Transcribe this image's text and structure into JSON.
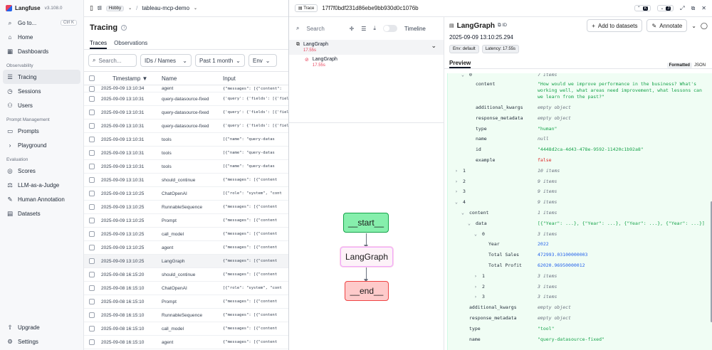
{
  "app": {
    "name": "Langfuse",
    "version": "v3.108.0"
  },
  "sidebar": {
    "goto": {
      "label": "Go to...",
      "shortcut": "Ctrl K"
    },
    "items_top": [
      {
        "label": "Home",
        "icon": "home-icon"
      },
      {
        "label": "Dashboards",
        "icon": "dashboard-icon"
      }
    ],
    "observability_label": "Observability",
    "observability_items": [
      {
        "label": "Tracing",
        "icon": "tracing-icon",
        "active": true
      },
      {
        "label": "Sessions",
        "icon": "sessions-icon"
      },
      {
        "label": "Users",
        "icon": "users-icon"
      }
    ],
    "prompt_label": "Prompt Management",
    "prompt_items": [
      {
        "label": "Prompts",
        "icon": "prompts-icon"
      },
      {
        "label": "Playground",
        "icon": "playground-icon"
      }
    ],
    "evaluation_label": "Evaluation",
    "evaluation_items": [
      {
        "label": "Scores",
        "icon": "scores-icon"
      },
      {
        "label": "LLM-as-a-Judge",
        "icon": "judge-icon"
      },
      {
        "label": "Human Annotation",
        "icon": "annotation-icon"
      },
      {
        "label": "Datasets",
        "icon": "datasets-icon"
      }
    ],
    "bottom_items": [
      {
        "label": "Upgrade",
        "icon": "upgrade-icon"
      },
      {
        "label": "Settings",
        "icon": "settings-icon"
      }
    ]
  },
  "topbar": {
    "org": "tll",
    "plan": "Hobby",
    "project": "tableau-mcp-demo"
  },
  "tracing": {
    "title": "Tracing",
    "tabs": [
      "Traces",
      "Observations"
    ],
    "search_placeholder": "Search...",
    "search_scope": "IDs / Names",
    "time_filter": "Past 1 month",
    "env_filter": "Env",
    "columns": {
      "timestamp": "Timestamp",
      "name": "Name",
      "input": "Input"
    },
    "rows": [
      {
        "ts": "2025-09-09 13:10:34",
        "name": "agent",
        "input": "{\"messages\": [{\"content\":"
      },
      {
        "ts": "2025-09-09 13:10:31",
        "name": "query-datasource-fixed",
        "input": "{'query': {'fields': [{'field"
      },
      {
        "ts": "2025-09-09 13:10:31",
        "name": "query-datasource-fixed",
        "input": "{'query': {'fields': [{'field"
      },
      {
        "ts": "2025-09-09 13:10:31",
        "name": "query-datasource-fixed",
        "input": "{'query': {'fields': [{'field"
      },
      {
        "ts": "2025-09-09 13:10:31",
        "name": "tools",
        "input": "[{\"name\": \"query-datas"
      },
      {
        "ts": "2025-09-09 13:10:31",
        "name": "tools",
        "input": "[{\"name\": \"query-datas"
      },
      {
        "ts": "2025-09-09 13:10:31",
        "name": "tools",
        "input": "[{\"name\": \"query-datas"
      },
      {
        "ts": "2025-09-09 13:10:31",
        "name": "should_continue",
        "input": "{\"messages\": [{\"content"
      },
      {
        "ts": "2025-09-09 13:10:25",
        "name": "ChatOpenAI",
        "input": "[{\"role\": \"system\", \"cont"
      },
      {
        "ts": "2025-09-09 13:10:25",
        "name": "RunnableSequence",
        "input": "{\"messages\": [{\"content"
      },
      {
        "ts": "2025-09-09 13:10:25",
        "name": "Prompt",
        "input": "{\"messages\": [{\"content"
      },
      {
        "ts": "2025-09-09 13:10:25",
        "name": "call_model",
        "input": "{\"messages\": [{\"content"
      },
      {
        "ts": "2025-09-09 13:10:25",
        "name": "agent",
        "input": "{\"messages\": [{\"content"
      },
      {
        "ts": "2025-09-09 13:10:25",
        "name": "LangGraph",
        "input": "{\"messages\": [{\"content",
        "highlight": true
      },
      {
        "ts": "2025-09-08 16:15:20",
        "name": "should_continue",
        "input": "{\"messages\": [{\"content"
      },
      {
        "ts": "2025-09-08 16:15:10",
        "name": "ChatOpenAI",
        "input": "[{\"role\": \"system\", \"cont"
      },
      {
        "ts": "2025-09-08 16:15:10",
        "name": "Prompt",
        "input": "{\"messages\": [{\"content"
      },
      {
        "ts": "2025-09-08 16:15:10",
        "name": "RunnableSequence",
        "input": "{\"messages\": [{\"content"
      },
      {
        "ts": "2025-09-08 16:15:10",
        "name": "call_model",
        "input": "{\"messages\": [{\"content"
      },
      {
        "ts": "2025-09-08 16:15:10",
        "name": "agent",
        "input": "{\"messages\": [{\"content"
      }
    ]
  },
  "trace": {
    "tag": "Trace",
    "id": "17f7f0bdf231d86ebe9bb930d0c1076b",
    "nav_up_key": "K",
    "nav_down_key": "J",
    "tree": {
      "search_placeholder": "Search",
      "timeline_label": "Timeline",
      "nodes": [
        {
          "name": "LangGraph",
          "duration": "17.55s"
        },
        {
          "name": "LangGraph",
          "duration": "17.55s"
        }
      ],
      "graph": {
        "start": "__start__",
        "middle": "LangGraph",
        "end": "__end__"
      }
    },
    "detail": {
      "title": "LangGraph",
      "id_label": "ID",
      "add_to_datasets": "Add to datasets",
      "annotate": "Annotate",
      "timestamp": "2025-09-09 13:10:25.294",
      "env": "Env: default",
      "latency": "Latency: 17.55s",
      "preview_tab": "Preview",
      "formatted": "Formatted",
      "json": "JSON",
      "json_rows": [
        {
          "indent": 1,
          "chev": "v",
          "key": "0",
          "val": "7 items",
          "type": "muted"
        },
        {
          "indent": 2,
          "chev": "",
          "key": "content",
          "val": "\"How would we improve performance in the business? What's working well, what areas need improvement, what lessons can we learn from the past?\"",
          "type": "str",
          "tall": true
        },
        {
          "indent": 2,
          "chev": "",
          "key": "additional_kwargs",
          "val": "empty object",
          "type": "muted"
        },
        {
          "indent": 2,
          "chev": "",
          "key": "response_metadata",
          "val": "empty object",
          "type": "muted"
        },
        {
          "indent": 2,
          "chev": "",
          "key": "type",
          "val": "\"human\"",
          "type": "str"
        },
        {
          "indent": 2,
          "chev": "",
          "key": "name",
          "val": "null",
          "type": "muted"
        },
        {
          "indent": 2,
          "chev": "",
          "key": "id",
          "val": "\"4448d2ca-4d43-478e-9592-11420c1b92a8\"",
          "type": "str"
        },
        {
          "indent": 2,
          "chev": "",
          "key": "example",
          "val": "false",
          "type": "bool"
        },
        {
          "indent": 0,
          "chev": ">",
          "key": "1",
          "val": "10 items",
          "type": "muted"
        },
        {
          "indent": 0,
          "chev": ">",
          "key": "2",
          "val": "9 items",
          "type": "muted"
        },
        {
          "indent": 0,
          "chev": ">",
          "key": "3",
          "val": "9 items",
          "type": "muted"
        },
        {
          "indent": 0,
          "chev": "v",
          "key": "4",
          "val": "9 items",
          "type": "muted"
        },
        {
          "indent": 1,
          "chev": "v",
          "key": "content",
          "val": "1 items",
          "type": "muted"
        },
        {
          "indent": 2,
          "chev": "v",
          "key": "data",
          "val": "[{\"Year\": ...}, {\"Year\": ...}, {\"Year\": ...}, {\"Year\": ...}]",
          "type": "str"
        },
        {
          "indent": 3,
          "chev": "v",
          "key": "0",
          "val": "3 items",
          "type": "muted"
        },
        {
          "indent": 4,
          "chev": "",
          "key": "Year",
          "val": "2022",
          "type": "num"
        },
        {
          "indent": 4,
          "chev": "",
          "key": "Total Sales",
          "val": "472993.03100000003",
          "type": "num"
        },
        {
          "indent": 4,
          "chev": "",
          "key": "Total Profit",
          "val": "62020.96950000012",
          "type": "num"
        },
        {
          "indent": 3,
          "chev": ">",
          "key": "1",
          "val": "3 items",
          "type": "muted"
        },
        {
          "indent": 3,
          "chev": ">",
          "key": "2",
          "val": "3 items",
          "type": "muted"
        },
        {
          "indent": 3,
          "chev": ">",
          "key": "3",
          "val": "3 items",
          "type": "muted"
        },
        {
          "indent": 1,
          "chev": "",
          "key": "additional_kwargs",
          "val": "empty object",
          "type": "muted"
        },
        {
          "indent": 1,
          "chev": "",
          "key": "response_metadata",
          "val": "empty object",
          "type": "muted"
        },
        {
          "indent": 1,
          "chev": "",
          "key": "type",
          "val": "\"tool\"",
          "type": "str"
        },
        {
          "indent": 1,
          "chev": "",
          "key": "name",
          "val": "\"query-datasource-fixed\"",
          "type": "str"
        }
      ]
    }
  }
}
